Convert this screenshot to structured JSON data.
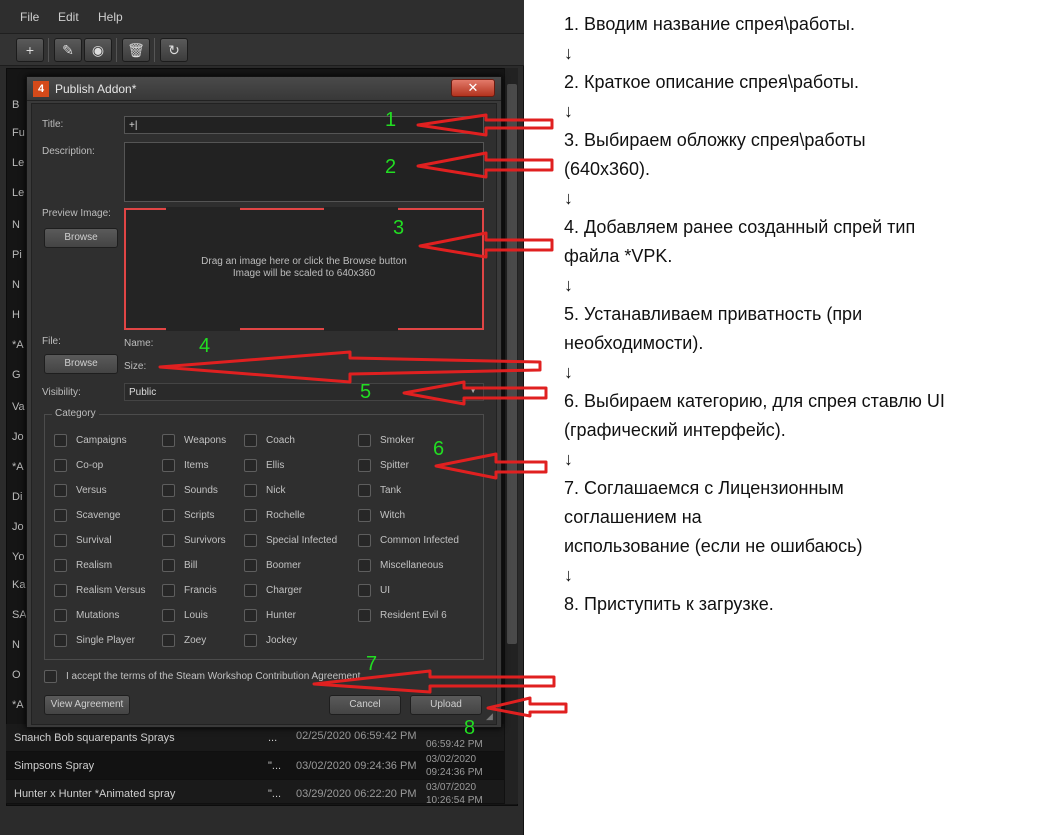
{
  "menu": [
    "File",
    "Edit",
    "Help"
  ],
  "toolbar": [
    {
      "icon": "add-icon",
      "glyph": "+"
    },
    {
      "icon": "edit-icon",
      "glyph": "✎"
    },
    {
      "icon": "view-icon",
      "glyph": "◉"
    },
    {
      "icon": "delete-icon",
      "glyph": "🗑"
    },
    {
      "icon": "refresh-icon",
      "glyph": "↻"
    }
  ],
  "left_truncated": [
    "B",
    "Fu",
    "Le",
    "Le",
    "N",
    "Pi",
    "N",
    "H",
    "*A",
    "G",
    "Va",
    "Jo",
    "*A",
    "Di",
    "Jo",
    "Yo",
    "Ka",
    "SA",
    "N",
    "O",
    "*A"
  ],
  "list_rows": [
    {
      "name": "Sпанch Bob squarepants Sprays",
      "dots": "...",
      "date1": "02/25/2020 06:59:42 PM",
      "date2": "",
      "date3": "06:59:42 PM"
    },
    {
      "name": "Simpsons Spray",
      "dots": "\"...",
      "date1": "03/02/2020 09:24:36 PM",
      "date2": "03/02/2020",
      "date3": "09:24:36 PM"
    },
    {
      "name": "Hunter x Hunter *Animated spray",
      "dots": "\"...",
      "date1": "03/29/2020 06:22:20 PM",
      "date2": "03/07/2020",
      "date3": "10:26:54 PM"
    }
  ],
  "dialog": {
    "title": "Publish Addon*",
    "close_glyph": "✕",
    "title_label": "Title:",
    "title_value": "+|",
    "description_label": "Description:",
    "preview_label": "Preview Image:",
    "browse_label": "Browse",
    "preview_hint_1": "Drag an image here or click the Browse button",
    "preview_hint_2": "Image will be scaled to 640x360",
    "file_label": "File:",
    "file_browse_label": "Browse",
    "name_label": "Name:",
    "size_label": "Size:",
    "visibility_label": "Visibility:",
    "visibility_value": "Public",
    "category_label": "Category",
    "categories": [
      [
        "Campaigns",
        "Weapons",
        "Coach",
        "Smoker"
      ],
      [
        "Co-op",
        "Items",
        "Ellis",
        "Spitter"
      ],
      [
        "Versus",
        "Sounds",
        "Nick",
        "Tank"
      ],
      [
        "Scavenge",
        "Scripts",
        "Rochelle",
        "Witch"
      ],
      [
        "Survival",
        "Survivors",
        "Special Infected",
        "Common Infected"
      ],
      [
        "Realism",
        "Bill",
        "Boomer",
        "Miscellaneous"
      ],
      [
        "Realism Versus",
        "Francis",
        "Charger",
        "UI"
      ],
      [
        "Mutations",
        "Louis",
        "Hunter",
        "Resident Evil 6"
      ],
      [
        "Single Player",
        "Zoey",
        "Jockey",
        ""
      ]
    ],
    "accept_label": "I accept the terms of the Steam Workshop Contribution Agreement",
    "view_agreement_label": "View Agreement",
    "cancel_label": "Cancel",
    "upload_label": "Upload"
  },
  "annotation_numbers": [
    "1",
    "2",
    "3",
    "4",
    "5",
    "6",
    "7",
    "8"
  ],
  "annotation_color": "#e02020",
  "number_color": "#22dd22",
  "instructions": [
    "1. Вводим название спрея\\работы.",
    "↓",
    "2. Краткое описание спрея\\работы.",
    "↓",
    "3. Выбираем обложку  спрея\\работы",
    "(640x360).",
    "↓",
    "4. Добавляем ранее созданный спрей тип",
    "файла *VPK.",
    "↓",
    "5. Устанавливаем приватность (при",
    "необходимости).",
    "↓",
    "6. Выбираем категорию, для спрея ставлю UI",
    "(графический интерфейс).",
    "↓",
    "7. Соглашаемся с Лицензионным",
    "соглашением на",
    "использование (если не ошибаюсь)",
    "↓",
    "8. Приступить к загрузке."
  ]
}
